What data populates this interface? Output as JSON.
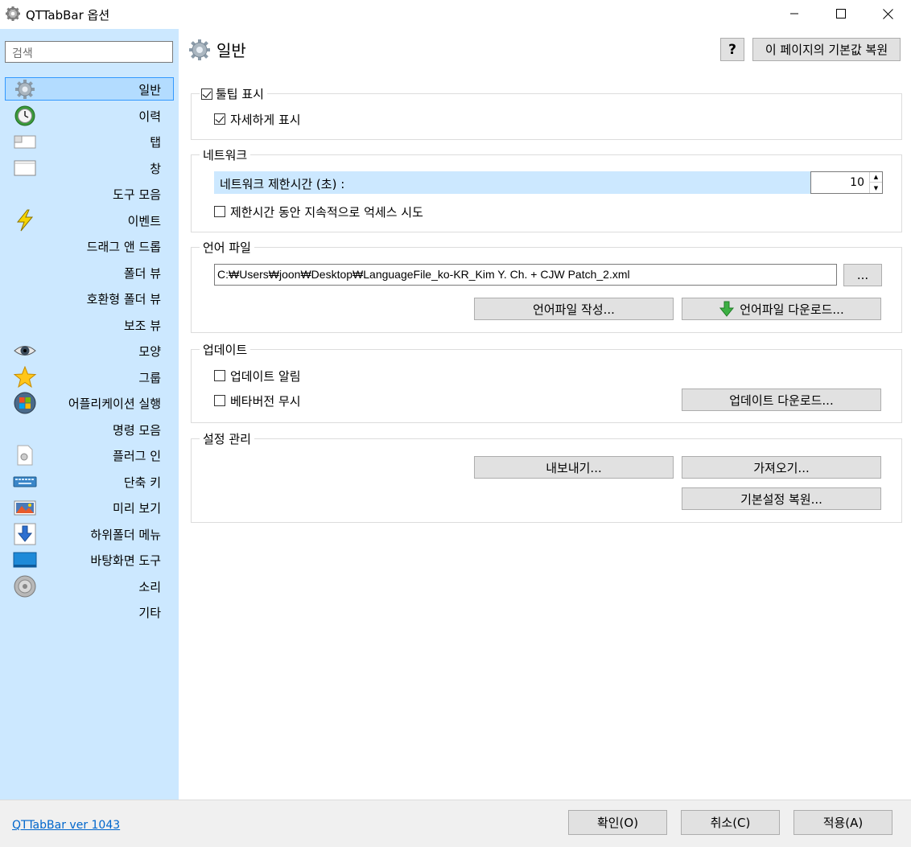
{
  "window": {
    "title": "QTTabBar 옵션",
    "minimize_icon": "minimize-icon",
    "maximize_icon": "maximize-icon",
    "close_icon": "close-icon"
  },
  "sidebar": {
    "search_placeholder": "검색",
    "items": [
      {
        "label": "일반",
        "icon": "gear-icon",
        "selected": true
      },
      {
        "label": "이력",
        "icon": "history-clock-icon"
      },
      {
        "label": "탭",
        "icon": "tab-icon"
      },
      {
        "label": "창",
        "icon": "window-icon"
      },
      {
        "label": "도구 모음",
        "icon": ""
      },
      {
        "label": "이벤트",
        "icon": "lightning-icon"
      },
      {
        "label": "드래그 앤 드롭",
        "icon": ""
      },
      {
        "label": "폴더 뷰",
        "icon": ""
      },
      {
        "label": "호환형 폴더 뷰",
        "icon": ""
      },
      {
        "label": "보조 뷰",
        "icon": ""
      },
      {
        "label": "모양",
        "icon": "eye-icon"
      },
      {
        "label": "그룹",
        "icon": "star-icon"
      },
      {
        "label": "어플리케이션 실행",
        "icon": "windows-orb-icon"
      },
      {
        "label": "명령 모음",
        "icon": ""
      },
      {
        "label": "플러그 인",
        "icon": "plugin-document-icon"
      },
      {
        "label": "단축 키",
        "icon": "keyboard-icon"
      },
      {
        "label": "미리 보기",
        "icon": "image-preview-icon"
      },
      {
        "label": "하위폴더 메뉴",
        "icon": "down-arrow-icon"
      },
      {
        "label": "바탕화면 도구",
        "icon": "desktop-icon"
      },
      {
        "label": "소리",
        "icon": "speaker-icon"
      },
      {
        "label": "기타",
        "icon": ""
      }
    ]
  },
  "main": {
    "title": "일반",
    "help_label": "?",
    "reset_page_label": "이 페이지의 기본값 복원",
    "tooltip_group": {
      "title": "툴팁 표시",
      "title_checked": true,
      "detail_label": "자세하게 표시",
      "detail_checked": true
    },
    "network_group": {
      "title": "네트워크",
      "timeout_label": "네트워크 제한시간 (초) :",
      "timeout_value": "10",
      "retry_label": "제한시간 동안 지속적으로 억세스 시도",
      "retry_checked": false
    },
    "language_group": {
      "title": "언어 파일",
      "path": "C:₩Users₩joon₩Desktop₩LanguageFile_ko-KR_Kim Y. Ch. + CJW Patch_2.xml",
      "browse_label": "...",
      "create_label": "언어파일 작성...",
      "download_label": "언어파일 다운로드..."
    },
    "update_group": {
      "title": "업데이트",
      "notify_label": "업데이트 알림",
      "notify_checked": false,
      "ignore_beta_label": "베타버전 무시",
      "ignore_beta_checked": false,
      "download_label": "업데이트 다운로드..."
    },
    "settings_group": {
      "title": "설정 관리",
      "export_label": "내보내기...",
      "import_label": "가져오기...",
      "restore_label": "기본설정 복원..."
    }
  },
  "footer": {
    "version": "QTTabBar ver 1043",
    "ok_label": "확인(O)",
    "cancel_label": "취소(C)",
    "apply_label": "적용(A)"
  }
}
